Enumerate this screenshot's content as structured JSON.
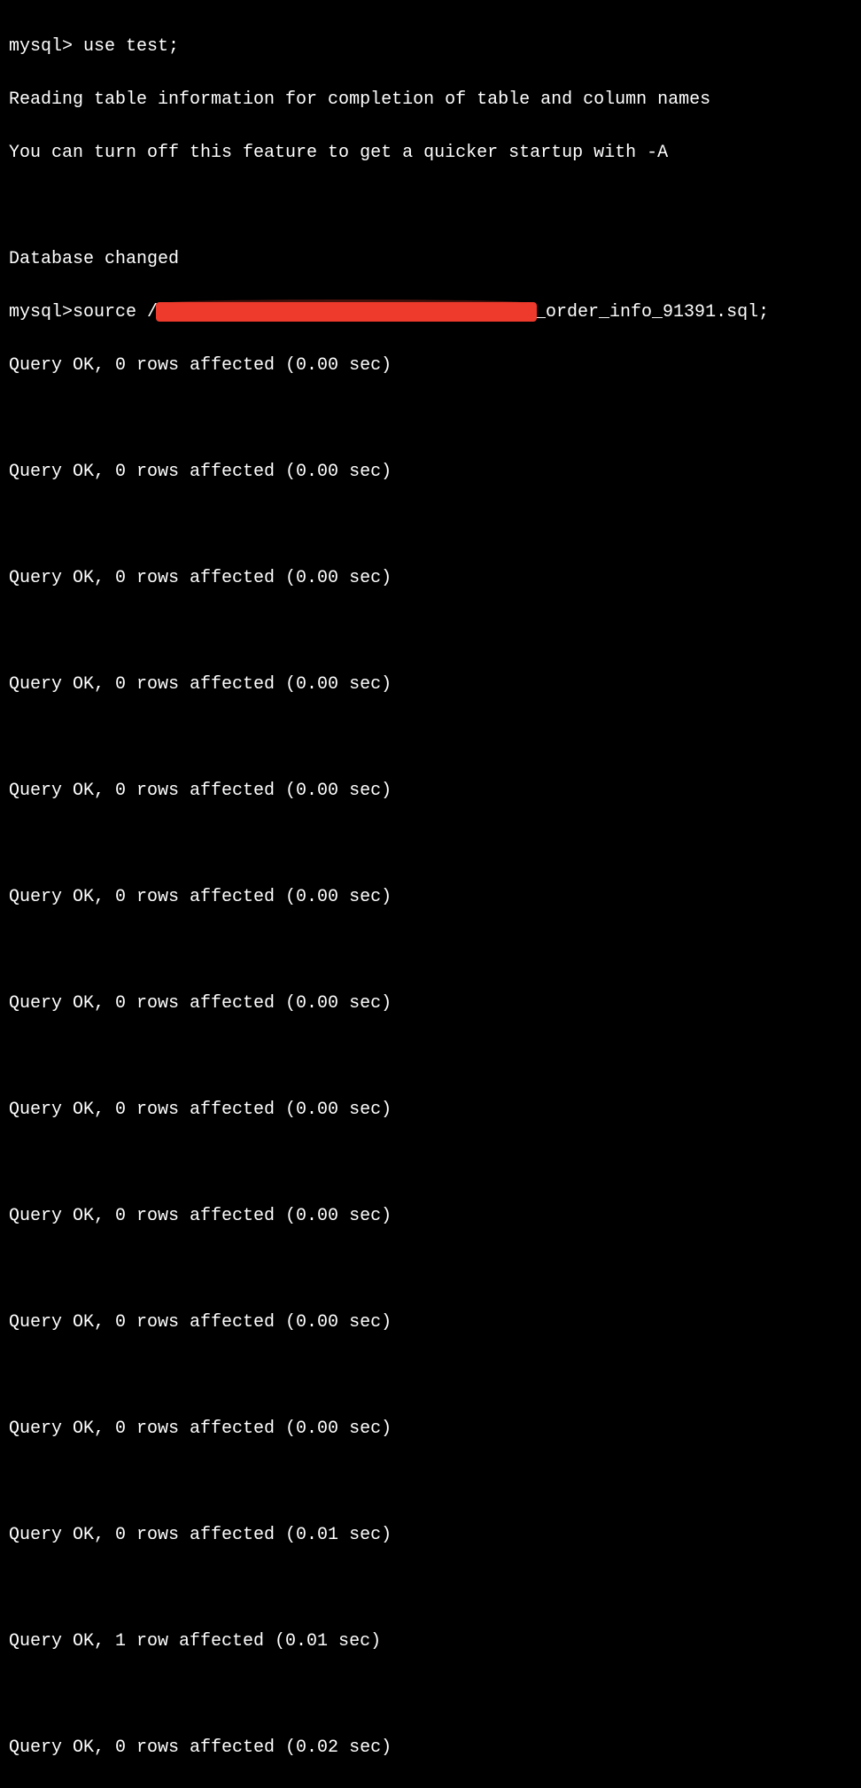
{
  "terminal": {
    "prompt": "mysql>",
    "cmd_use": "use test;",
    "info_line1": "Reading table information for completion of table and column names",
    "info_line2": "You can turn off this feature to get a quicker startup with -A",
    "db_changed": "Database changed",
    "cmd_source_prefix": "source /",
    "cmd_source_suffix": "_order_info_91391.sql;",
    "results": [
      "Query OK, 0 rows affected (0.00 sec)",
      "Query OK, 0 rows affected (0.00 sec)",
      "Query OK, 0 rows affected (0.00 sec)",
      "Query OK, 0 rows affected (0.00 sec)",
      "Query OK, 0 rows affected (0.00 sec)",
      "Query OK, 0 rows affected (0.00 sec)",
      "Query OK, 0 rows affected (0.00 sec)",
      "Query OK, 0 rows affected (0.00 sec)",
      "Query OK, 0 rows affected (0.00 sec)",
      "Query OK, 0 rows affected (0.00 sec)",
      "Query OK, 0 rows affected (0.00 sec)",
      "Query OK, 0 rows affected (0.01 sec)",
      "Query OK, 1 row affected (0.01 sec)",
      "Query OK, 0 rows affected (0.02 sec)"
    ]
  }
}
